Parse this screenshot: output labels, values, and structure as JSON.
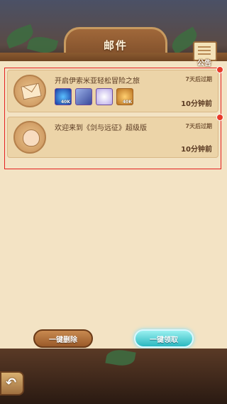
{
  "header": {
    "title": "邮件"
  },
  "notice": {
    "label": "公告"
  },
  "mails": [
    {
      "title": "开启伊索米亚轻松冒险之旅",
      "expire": "7天后过期",
      "time": "10分钟前",
      "icon": "envelope-icon",
      "rewards": [
        {
          "icon": "blue-orb-icon",
          "qty": "40K"
        },
        {
          "icon": "scroll-icon",
          "qty": ""
        },
        {
          "icon": "diamond-icon",
          "qty": ""
        },
        {
          "icon": "gold-coin-icon",
          "qty": "40K"
        }
      ]
    },
    {
      "title": "欢迎来到《剑与远征》超级版",
      "expire": "7天后过期",
      "time": "10分钟前",
      "icon": "pouch-icon"
    }
  ],
  "buttons": {
    "delete_all": "一键删除",
    "claim_all": "一键领取"
  },
  "colors": {
    "accent": "#2ab8c0",
    "badge": "#e83a2a",
    "panel": "#f3e3c4"
  }
}
